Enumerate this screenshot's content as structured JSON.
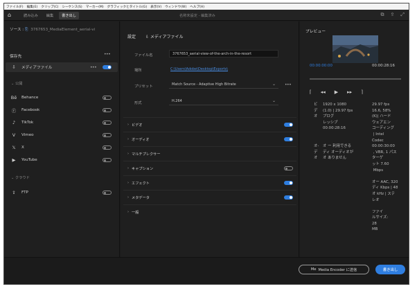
{
  "menu": [
    "ファイル(F)",
    "編集(E)",
    "クリップ(C)",
    "シーケンス(S)",
    "マーカー(M)",
    "グラフィックとタイトル(G)",
    "表示(V)",
    "ウィンドウ(W)",
    "ヘルプ(H)"
  ],
  "tabs": [
    "読み込み",
    "編集",
    "書き出し"
  ],
  "project": "名称未設定 - 編集済み",
  "source": {
    "label": "ソース :",
    "name": "3767653_MediaElement_aerial-vi"
  },
  "destinations_title": "保存先",
  "media_file": "メディアファイル",
  "social_heading": "公開",
  "social": [
    "Behance",
    "Facebook",
    "TikTok",
    "Vimeo",
    "X",
    "YouTube"
  ],
  "cloud_heading": "クラウド",
  "cloud": [
    "FTP"
  ],
  "mid": {
    "settings": "設定",
    "media_file": "メディアファイル",
    "labels": {
      "filename": "ファイル名",
      "location": "場所",
      "preset": "プリセット",
      "format": "形式"
    },
    "filename": "3767653_aerial-view-of-the-arch-in-the-resort",
    "location": "C:\\Users\\Adobe\\Desktop\\Exports\\",
    "preset": "Match Source - Adaptive High Bitrate",
    "format": "H.264",
    "sections": [
      "ビデオ",
      "オーディオ",
      "マルチプレクサー",
      "キャプション",
      "エフェクト",
      "メタデータ",
      "一般"
    ],
    "section_toggles": [
      "on",
      "on",
      "none",
      "off",
      "on",
      "on",
      "none"
    ]
  },
  "preview": {
    "title": "プレビュー",
    "time_start": "00:00:00:00",
    "time_end": "00:00:28:16",
    "summary_labels": "ビ\nデ\nオ\n\n\n\n\nオ-\nデ\nオ",
    "summary_col2": "1920 x 1080\n(1.0) | 29.97 fps\nプログ\nレッシブ\n00:00:28:16\n\n\nオ ー 利用できる\nディ オーディオが\nオ ありません",
    "summary_col3": "29.97 fps\n16.6, 58%\n(K)| ハード\nウェアエン\nコーディング\n | Intel\nCodec\n00:00:30:00\n , VBR, 1 パス\nターゲ\nット 7.60\n Mbps\n\nオー AAC, 320\nディ Kbps | 48\nオ kHz | ステ\nレオ\n\nファイ\nルサイズ:\n28\nMB"
  },
  "buttons": {
    "media_encoder": "Media Encoder に送信",
    "export": "書き出し"
  },
  "colors": {
    "accent": "#2f7ee0"
  }
}
